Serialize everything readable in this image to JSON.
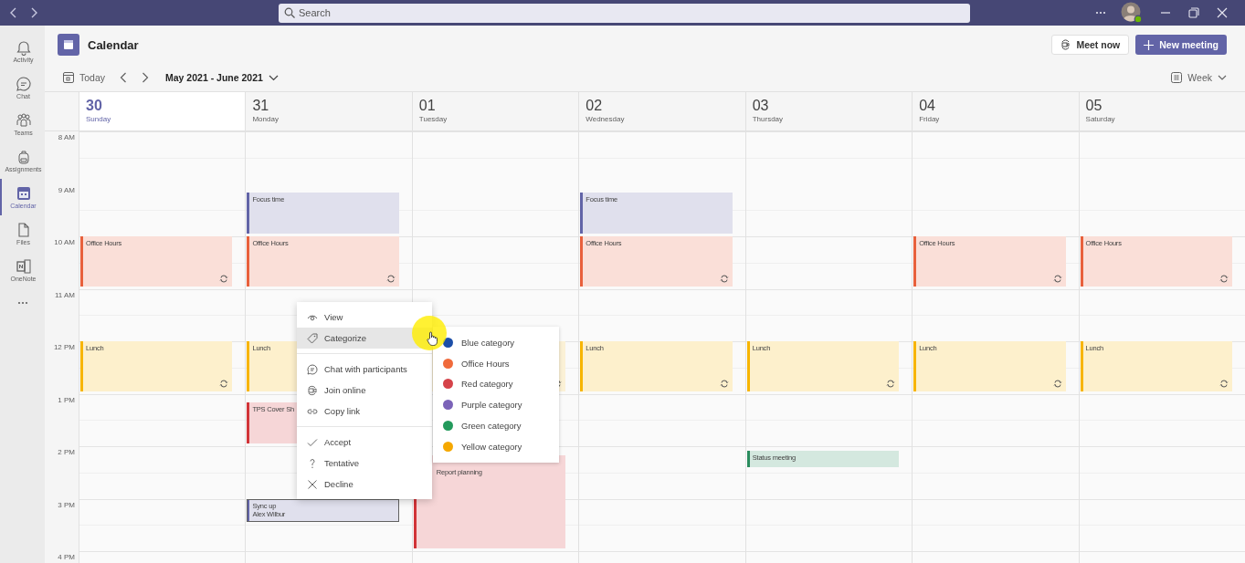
{
  "title_bar": {
    "search": {
      "placeholder": "Search"
    }
  },
  "rail": [
    {
      "label": "Activity",
      "selected": false
    },
    {
      "label": "Chat",
      "selected": false
    },
    {
      "label": "Teams",
      "selected": false
    },
    {
      "label": "Assignments",
      "selected": false
    },
    {
      "label": "Calendar",
      "selected": true
    },
    {
      "label": "Files",
      "selected": false
    },
    {
      "label": "OneNote",
      "selected": false
    }
  ],
  "header": {
    "title": "Calendar",
    "meet_now": "Meet now",
    "new_meeting": "New meeting"
  },
  "toolbar": {
    "today": "Today",
    "range": "May 2021 - June 2021",
    "view": "Week"
  },
  "hours": [
    "8 AM",
    "9 AM",
    "10 AM",
    "11 AM",
    "12 PM",
    "1 PM",
    "2 PM",
    "3 PM",
    "4 PM"
  ],
  "days": [
    {
      "number": "30",
      "name": "Sunday",
      "selected": true,
      "events": [
        {
          "title": "Office Hours",
          "color": "#e8603c",
          "recurring": true,
          "selected": false
        },
        {
          "title": "Lunch",
          "color": "#f7b500",
          "recurring": true,
          "selected": false
        }
      ]
    },
    {
      "number": "31",
      "name": "Monday",
      "selected": false,
      "events": [
        {
          "title": "Focus time",
          "color": "#6264a7",
          "recurring": false,
          "selected": false
        },
        {
          "title": "Office Hours",
          "color": "#e8603c",
          "recurring": true,
          "selected": false
        },
        {
          "title": "Lunch",
          "color": "#f7b500",
          "selected": false
        },
        {
          "title": "TPS Cover Sh",
          "color": "#d13438",
          "selected": false
        },
        {
          "title": "Sync up",
          "organizer": "Alex Wilbur",
          "color": "#6264a7",
          "recurring": false,
          "selected": true
        }
      ]
    },
    {
      "number": "01",
      "name": "Tuesday",
      "selected": false,
      "events": [
        {
          "recurring": true,
          "selected": false
        },
        {
          "title": "Report planning",
          "color": "#d13438",
          "recurring": false,
          "selected": false
        }
      ]
    },
    {
      "number": "02",
      "name": "Wednesday",
      "selected": false,
      "events": [
        {
          "title": "Focus time",
          "color": "#6264a7",
          "recurring": false,
          "selected": false
        },
        {
          "title": "Office Hours",
          "color": "#e8603c",
          "recurring": true,
          "selected": false
        },
        {
          "title": "Lunch",
          "color": "#f7b500",
          "recurring": true,
          "selected": false
        }
      ]
    },
    {
      "number": "03",
      "name": "Thursday",
      "selected": false,
      "events": [
        {
          "title": "Lunch",
          "color": "#f7b500",
          "recurring": true,
          "selected": false
        },
        {
          "title": "Status meeting",
          "color": "#2a8c5e",
          "recurring": false,
          "selected": false
        }
      ]
    },
    {
      "number": "04",
      "name": "Friday",
      "selected": false,
      "events": [
        {
          "title": "Office Hours",
          "color": "#e8603c",
          "recurring": true,
          "selected": false
        },
        {
          "title": "Lunch",
          "color": "#f7b500",
          "recurring": true,
          "selected": false
        }
      ]
    },
    {
      "number": "05",
      "name": "Saturday",
      "selected": false,
      "events": [
        {
          "title": "Office Hours",
          "color": "#e8603c",
          "recurring": true,
          "selected": false
        },
        {
          "title": "Lunch",
          "color": "#f7b500",
          "recurring": true,
          "selected": false
        }
      ]
    }
  ],
  "context_menu": {
    "groups": [
      [
        {
          "label": "View",
          "selected": false
        },
        {
          "label": "Categorize",
          "selected": true
        }
      ],
      [
        {
          "label": "Chat with participants",
          "selected": false
        },
        {
          "label": "Join online",
          "selected": false
        },
        {
          "label": "Copy link",
          "selected": false
        }
      ],
      [
        {
          "label": "Accept",
          "selected": false
        },
        {
          "label": "Tentative",
          "selected": false
        },
        {
          "label": "Decline",
          "selected": false
        }
      ]
    ]
  },
  "categories": [
    {
      "label": "Blue category",
      "color": "#1c4fa8"
    },
    {
      "label": "Office Hours",
      "color": "#f06a3b"
    },
    {
      "label": "Red category",
      "color": "#d54349"
    },
    {
      "label": "Purple category",
      "color": "#7b63b8"
    },
    {
      "label": "Green category",
      "color": "#239a5c"
    },
    {
      "label": "Yellow category",
      "color": "#f5a800"
    }
  ]
}
